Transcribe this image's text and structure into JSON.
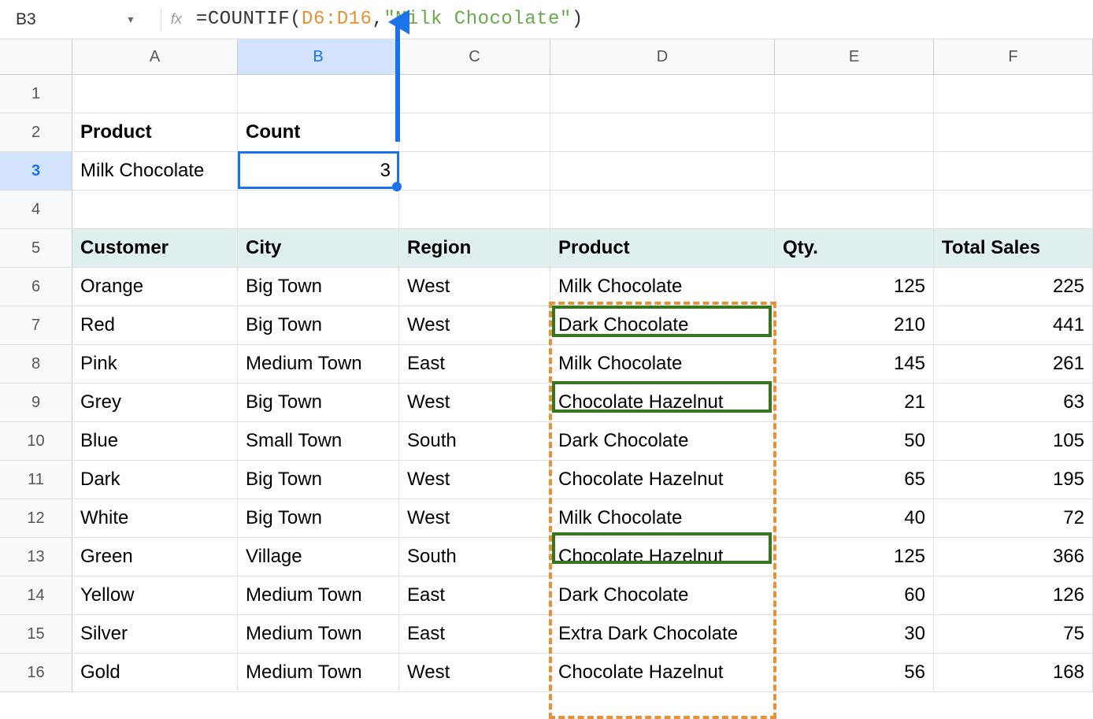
{
  "formula_bar": {
    "cell_ref": "B3",
    "fx_label": "fx",
    "formula": {
      "func": "COUNTIF",
      "range": "D6:D16",
      "string": "\"Milk Chocolate\""
    }
  },
  "columns": [
    "A",
    "B",
    "C",
    "D",
    "E",
    "F"
  ],
  "rows": [
    {
      "num": "1",
      "cells": [
        "",
        "",
        "",
        "",
        "",
        ""
      ]
    },
    {
      "num": "2",
      "cells": [
        "Product",
        "Count",
        "",
        "",
        "",
        ""
      ],
      "bold": true
    },
    {
      "num": "3",
      "cells": [
        "Milk Chocolate",
        "3",
        "",
        "",
        "",
        ""
      ],
      "selected": true
    },
    {
      "num": "4",
      "cells": [
        "",
        "",
        "",
        "",
        "",
        ""
      ]
    },
    {
      "num": "5",
      "cells": [
        "Customer",
        "City",
        "Region",
        "Product",
        "Qty.",
        "Total Sales"
      ],
      "header": true
    },
    {
      "num": "6",
      "cells": [
        "Orange",
        "Big Town",
        "West",
        "Milk Chocolate",
        "125",
        "225"
      ]
    },
    {
      "num": "7",
      "cells": [
        "Red",
        "Big Town",
        "West",
        "Dark Chocolate",
        "210",
        "441"
      ]
    },
    {
      "num": "8",
      "cells": [
        "Pink",
        "Medium Town",
        "East",
        "Milk Chocolate",
        "145",
        "261"
      ]
    },
    {
      "num": "9",
      "cells": [
        "Grey",
        "Big Town",
        "West",
        "Chocolate Hazelnut",
        "21",
        "63"
      ]
    },
    {
      "num": "10",
      "cells": [
        "Blue",
        "Small Town",
        "South",
        "Dark Chocolate",
        "50",
        "105"
      ]
    },
    {
      "num": "11",
      "cells": [
        "Dark",
        "Big Town",
        "West",
        "Chocolate Hazelnut",
        "65",
        "195"
      ]
    },
    {
      "num": "12",
      "cells": [
        "White",
        "Big Town",
        "West",
        "Milk Chocolate",
        "40",
        "72"
      ]
    },
    {
      "num": "13",
      "cells": [
        "Green",
        "Village",
        "South",
        "Chocolate Hazelnut",
        "125",
        "366"
      ]
    },
    {
      "num": "14",
      "cells": [
        "Yellow",
        "Medium Town",
        "East",
        "Dark Chocolate",
        "60",
        "126"
      ]
    },
    {
      "num": "15",
      "cells": [
        "Silver",
        "Medium Town",
        "East",
        "Extra Dark Chocolate",
        "30",
        "75"
      ]
    },
    {
      "num": "16",
      "cells": [
        "Gold",
        "Medium Town",
        "West",
        "Chocolate Hazelnut",
        "56",
        "168"
      ]
    }
  ],
  "numeric_cols": [
    4,
    5
  ],
  "selected_col": "B"
}
